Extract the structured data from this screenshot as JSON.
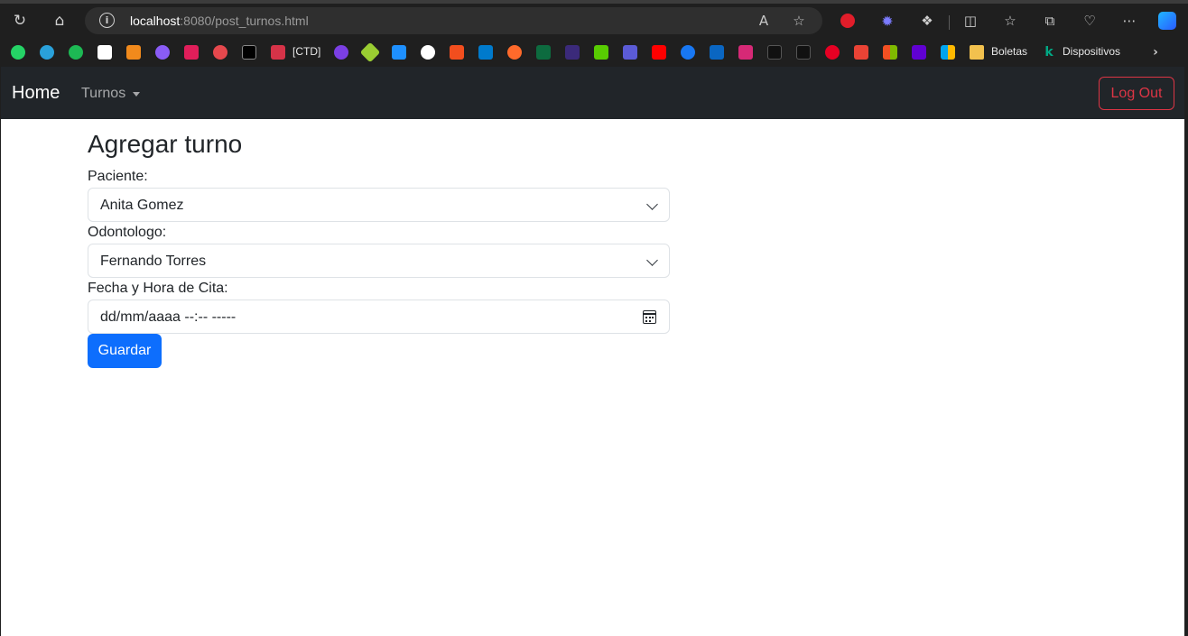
{
  "browser": {
    "url_host": "localhost",
    "url_path": ":8080/post_turnos.html",
    "icons": [
      "refresh-icon",
      "home-icon",
      "info-icon",
      "read-aloud-icon",
      "favorite-star-icon",
      "adblock-icon",
      "extension-icon",
      "puzzle-icon",
      "split-screen-icon",
      "favorites-icon",
      "collections-icon",
      "health-icon",
      "more-icon",
      "copilot-icon"
    ]
  },
  "bookmarks": {
    "ctd_label": "[CTD]",
    "boletas_label": "Boletas",
    "dispositivos_label": "Dispositivos"
  },
  "navbar": {
    "brand": "Home",
    "menu": "Turnos",
    "logout": "Log Out"
  },
  "form": {
    "title": "Agregar turno",
    "paciente_label": "Paciente:",
    "paciente_value": "Anita Gomez",
    "odontologo_label": "Odontologo:",
    "odontologo_value": "Fernando Torres",
    "fecha_label": "Fecha y Hora de Cita:",
    "fecha_placeholder": "dd/mm/aaaa --:--  -----",
    "submit": "Guardar"
  },
  "colors": {
    "navbar_bg": "#212529",
    "primary": "#0d6efd",
    "danger": "#dc3545"
  }
}
